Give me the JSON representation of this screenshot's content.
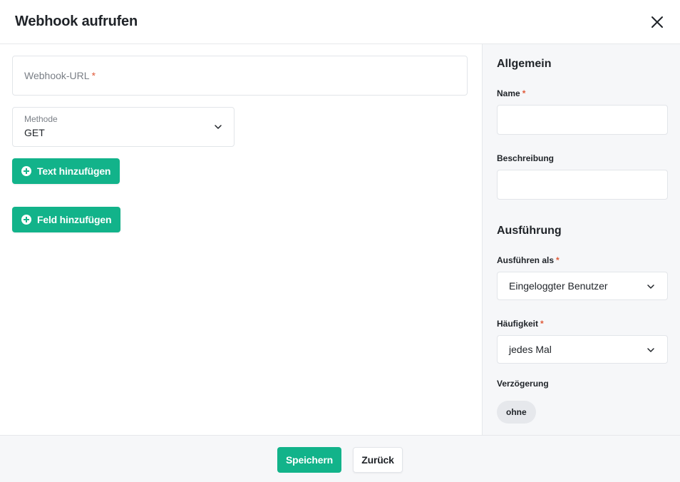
{
  "dialog": {
    "title": "Webhook aufrufen"
  },
  "form": {
    "url_label": "Webhook-URL",
    "url_required": "*",
    "method_label": "Methode",
    "method_value": "GET",
    "add_text_label": "Text hinzufügen",
    "add_field_label": "Feld hinzufügen"
  },
  "sidebar": {
    "general_title": "Allgemein",
    "name_label": "Name",
    "name_required": "*",
    "name_value": "",
    "description_label": "Beschreibung",
    "description_value": "",
    "execution_title": "Ausführung",
    "execute_as_label": "Ausführen als",
    "execute_as_required": "*",
    "execute_as_value": "Eingeloggter Benutzer",
    "frequency_label": "Häufigkeit",
    "frequency_required": "*",
    "frequency_value": "jedes Mal",
    "delay_label": "Verzögerung",
    "delay_value": "ohne"
  },
  "footer": {
    "save_label": "Speichern",
    "back_label": "Zurück"
  },
  "colors": {
    "accent": "#12b38a",
    "required": "#e05b3a",
    "panel_bg": "#f6f7f9"
  },
  "icons": {
    "close": "close-icon",
    "chevron": "chevron-down-icon",
    "add": "plus-circle-icon"
  }
}
